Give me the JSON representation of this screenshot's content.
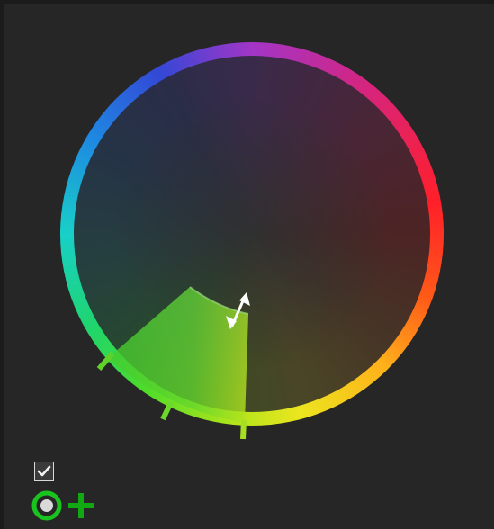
{
  "panel": {
    "background": "#262626",
    "controls": {
      "enable_checkbox": {
        "checked": true,
        "icon": "checkmark-icon"
      },
      "target_button": {
        "icon": "target-icon",
        "color": "#19c41f"
      },
      "add_button": {
        "icon": "plus-icon",
        "color": "#11a814"
      }
    }
  },
  "color_wheel": {
    "ring_icon": "hue-ring",
    "selection_color": "#62d92c",
    "handle_icon": "resize-handle-icon",
    "markers_color": "#6ad92a"
  }
}
